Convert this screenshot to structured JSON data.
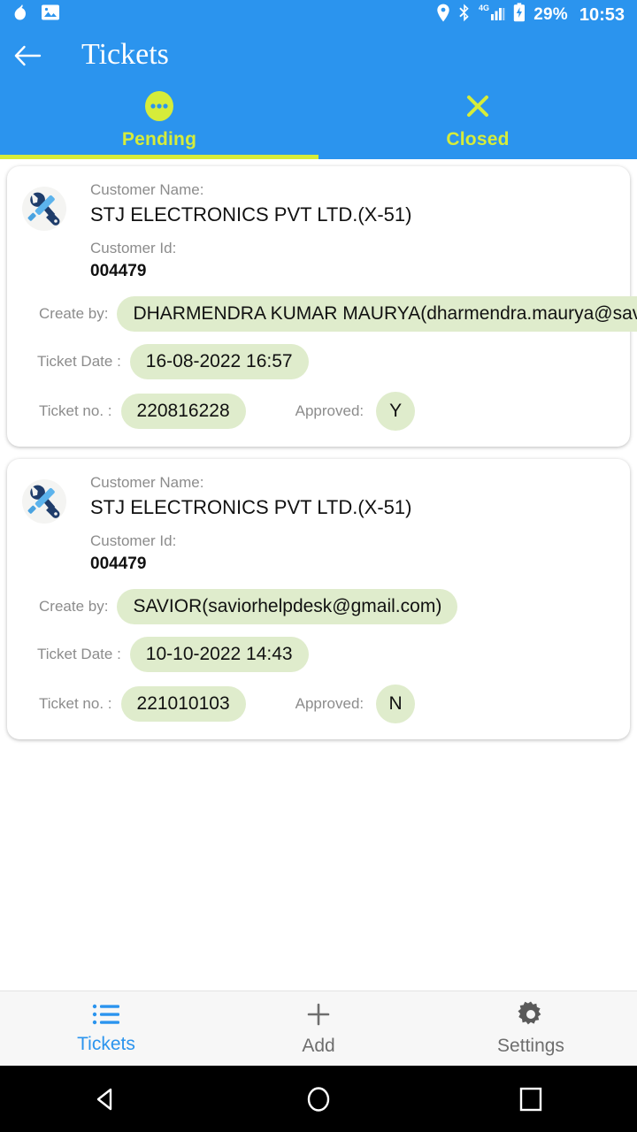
{
  "statusbar": {
    "left_icons": [
      "droplet-icon",
      "image-icon"
    ],
    "right_icons": [
      "location-pin-icon",
      "bluetooth-icon",
      "signal-4g-icon",
      "battery-charging-icon"
    ],
    "network": "4G",
    "battery_percent": "29%",
    "time": "10:53"
  },
  "appbar": {
    "back_icon": "back-arrow-icon",
    "title": "Tickets",
    "accent_color": "#2b94ee",
    "tab_accent_color": "#d6ec3a"
  },
  "tabs": [
    {
      "label": "Pending",
      "icon": "pending-dots-icon",
      "active": true
    },
    {
      "label": "Closed",
      "icon": "close-x-icon",
      "active": false
    }
  ],
  "labels": {
    "customer_name": "Customer Name:",
    "customer_id": "Customer Id:",
    "create_by": "Create by:",
    "ticket_date": "Ticket Date :",
    "ticket_no": "Ticket no. :",
    "approved": "Approved:"
  },
  "tickets": [
    {
      "icon": "tools-wrench-screwdriver-icon",
      "customer_name": "STJ ELECTRONICS PVT LTD.(X-51)",
      "customer_id": "004479",
      "create_by": "DHARMENDRA KUMAR MAURYA(dharmendra.maurya@saviorstj.com)",
      "ticket_date": "16-08-2022 16:57",
      "ticket_no": "220816228",
      "approved": "Y"
    },
    {
      "icon": "tools-wrench-screwdriver-icon",
      "customer_name": "STJ ELECTRONICS PVT LTD.(X-51)",
      "customer_id": "004479",
      "create_by": "SAVIOR(saviorhelpdesk@gmail.com)",
      "ticket_date": "10-10-2022 14:43",
      "ticket_no": "221010103",
      "approved": "N"
    }
  ],
  "bottomnav": [
    {
      "label": "Tickets",
      "icon": "list-icon",
      "active": true
    },
    {
      "label": "Add",
      "icon": "plus-icon",
      "active": false
    },
    {
      "label": "Settings",
      "icon": "gear-icon",
      "active": false
    }
  ],
  "sysnav": [
    "back-triangle-icon",
    "home-circle-icon",
    "recents-square-icon"
  ],
  "chip_color": "#dfeccc"
}
